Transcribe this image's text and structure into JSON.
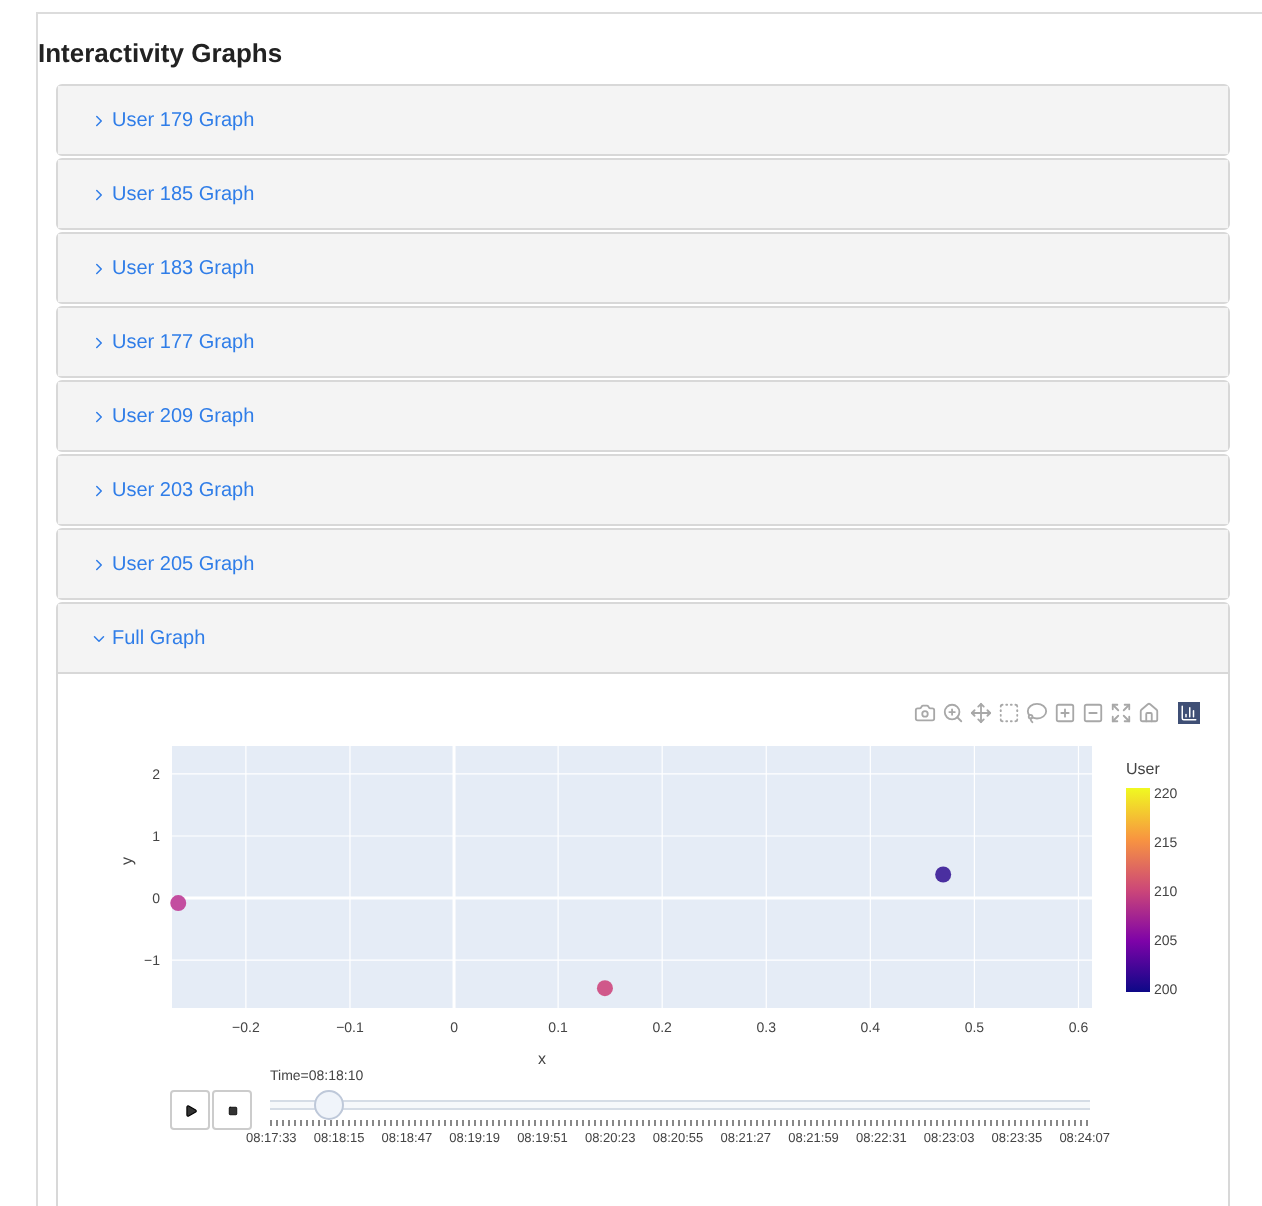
{
  "title": "Interactivity Graphs",
  "accordion": [
    {
      "label": "User 179 Graph",
      "expanded": false
    },
    {
      "label": "User 185 Graph",
      "expanded": false
    },
    {
      "label": "User 183 Graph",
      "expanded": false
    },
    {
      "label": "User 177 Graph",
      "expanded": false
    },
    {
      "label": "User 209 Graph",
      "expanded": false
    },
    {
      "label": "User 203 Graph",
      "expanded": false
    },
    {
      "label": "User 205 Graph",
      "expanded": false
    },
    {
      "label": "Full Graph",
      "expanded": true
    }
  ],
  "chart": {
    "chart_data": {
      "type": "scatter",
      "xlabel": "x",
      "ylabel": "y",
      "x": [
        -0.265,
        0.145,
        0.47
      ],
      "grid": true,
      "series": [
        {
          "color": "#c34ea0",
          "values": [
            -0.08,
            null,
            null
          ]
        },
        {
          "color": "#d0588a",
          "values": [
            null,
            -1.45,
            null
          ]
        },
        {
          "color": "#4a2fa0",
          "values": [
            null,
            null,
            0.38
          ]
        }
      ],
      "xlim": [
        -0.271,
        0.613
      ],
      "ylim": [
        -1.77,
        2.45
      ],
      "xticks": [
        {
          "value": -0.2,
          "label": "−0.2"
        },
        {
          "value": -0.1,
          "label": "−0.1"
        },
        {
          "value": 0,
          "label": "0"
        },
        {
          "value": 0.1,
          "label": "0.1"
        },
        {
          "value": 0.2,
          "label": "0.2"
        },
        {
          "value": 0.3,
          "label": "0.3"
        },
        {
          "value": 0.4,
          "label": "0.4"
        },
        {
          "value": 0.5,
          "label": "0.5"
        },
        {
          "value": 0.6,
          "label": "0.6"
        }
      ],
      "yticks": [
        {
          "value": -1,
          "label": "−1"
        },
        {
          "value": 0,
          "label": "0"
        },
        {
          "value": 1,
          "label": "1"
        },
        {
          "value": 2,
          "label": "2"
        }
      ]
    },
    "colorbar": {
      "title": "User",
      "ticks": [
        "220",
        "215",
        "210",
        "205",
        "200"
      ]
    }
  },
  "animation": {
    "label": "Time=08:18:10",
    "level": 0.07,
    "ticks": [
      "08:17:33",
      "08:18:15",
      "08:18:47",
      "08:19:19",
      "08:19:51",
      "08:20:23",
      "08:20:55",
      "08:21:27",
      "08:21:59",
      "08:22:31",
      "08:23:03",
      "08:23:35",
      "08:24:07"
    ]
  }
}
